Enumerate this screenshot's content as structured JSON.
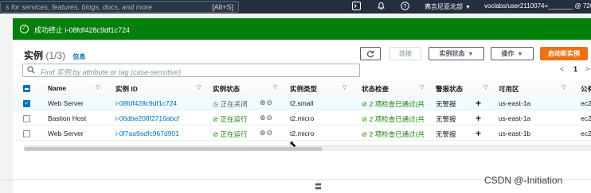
{
  "topbar": {
    "search_placeholder": "s for services, features, blogs, docs, and more",
    "search_shortcut": "[Alt+S]",
    "region": "弗吉尼亚北部",
    "account": "voclabs/user2110074=_______ @ 726"
  },
  "flash": {
    "message": "成功终止 i-08fdf428c9df1c724",
    "status": "success"
  },
  "instances_panel": {
    "title": "实例",
    "count": "(1/3)",
    "info_link": "信息",
    "buttons": {
      "refresh_icon": "refresh-icon",
      "connect": "连接",
      "instance_state": "实例状态",
      "actions": "操作",
      "launch": "启动新实例"
    },
    "filter_placeholder": "Find 实例 by attribute or tag (case-sensitive)",
    "pagination": {
      "prev": "<",
      "current": "1",
      "next": ">"
    }
  },
  "table": {
    "columns": [
      "Name",
      "实例 ID",
      "实例状态",
      "实例类型",
      "状态检查",
      "警报状态",
      "可用区",
      "公有"
    ],
    "rows": [
      {
        "selected": true,
        "name": "Web Server",
        "instance_id": "i-08fdf428c9df1c724",
        "state": "正在关闭",
        "state_type": "stopping",
        "type": "t2.small",
        "check": "2 项检查已通过(共",
        "alarm": "无警报",
        "zone": "us-east-1a",
        "public": "ec2"
      },
      {
        "selected": false,
        "name": "Bastion Host",
        "instance_id": "i-06dbe208f2716abcf",
        "state": "正在运行",
        "state_type": "running",
        "type": "t2.micro",
        "check": "2 项检查已通过(共",
        "alarm": "无警报",
        "zone": "us-east-1a",
        "public": "ec2"
      },
      {
        "selected": false,
        "name": "Web Server",
        "instance_id": "i-0f7aa9adfc967d901",
        "state": "正在运行",
        "state_type": "running",
        "type": "t2.micro",
        "check": "2 项检查已通过(共",
        "alarm": "无警报",
        "zone": "us-east-1b",
        "public": "ec2"
      }
    ]
  },
  "watermark": "CSDN @-Initiation",
  "colors": {
    "topbar": "#232f3e",
    "flash_success": "#037f0c",
    "primary_button": "#ec7211",
    "link": "#0073bb",
    "ok_status": "#1d8102"
  }
}
